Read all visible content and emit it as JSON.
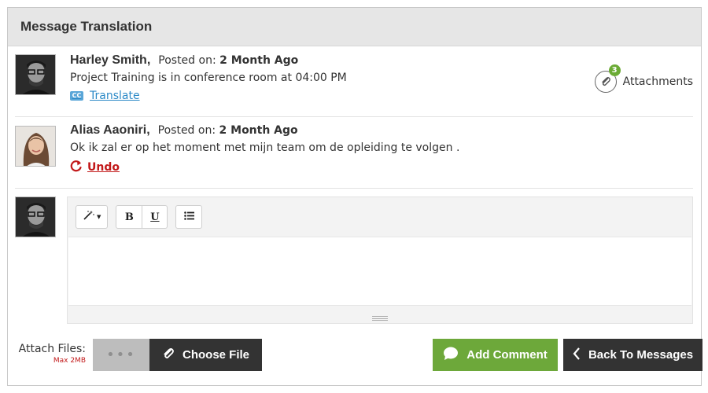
{
  "panel": {
    "title": "Message Translation"
  },
  "messages": [
    {
      "author": "Harley Smith,",
      "posted_prefix": "Posted on:",
      "posted_time": "2 Month Ago",
      "text": "Project Training is in conference room at 04:00 PM",
      "action_label": "Translate",
      "action_icon": "cc-icon",
      "attachments": {
        "label": "Attachments",
        "count": "3"
      }
    },
    {
      "author": "Alias Aaoniri,",
      "posted_prefix": "Posted on:",
      "posted_time": "2 Month Ago",
      "text": "Ok ik zal er op het moment met mijn team om de opleiding te volgen .",
      "action_label": "Undo",
      "action_icon": "undo-icon"
    }
  ],
  "editor": {
    "toolbar": {
      "style_icon": "magic-wand-icon",
      "bold_label": "B",
      "underline_label": "U",
      "list_icon": "unordered-list-icon"
    },
    "content": ""
  },
  "footer": {
    "attach_label": "Attach Files:",
    "max_size": "Max 2MB",
    "file_placeholder": "•••",
    "choose_label": "Choose File",
    "add_comment_label": "Add Comment",
    "back_label": "Back To Messages"
  },
  "colors": {
    "green": "#6da83a",
    "dark": "#333333",
    "link_blue": "#2d8ac7",
    "undo_red": "#c2191a",
    "badge_green": "#6bab35"
  }
}
